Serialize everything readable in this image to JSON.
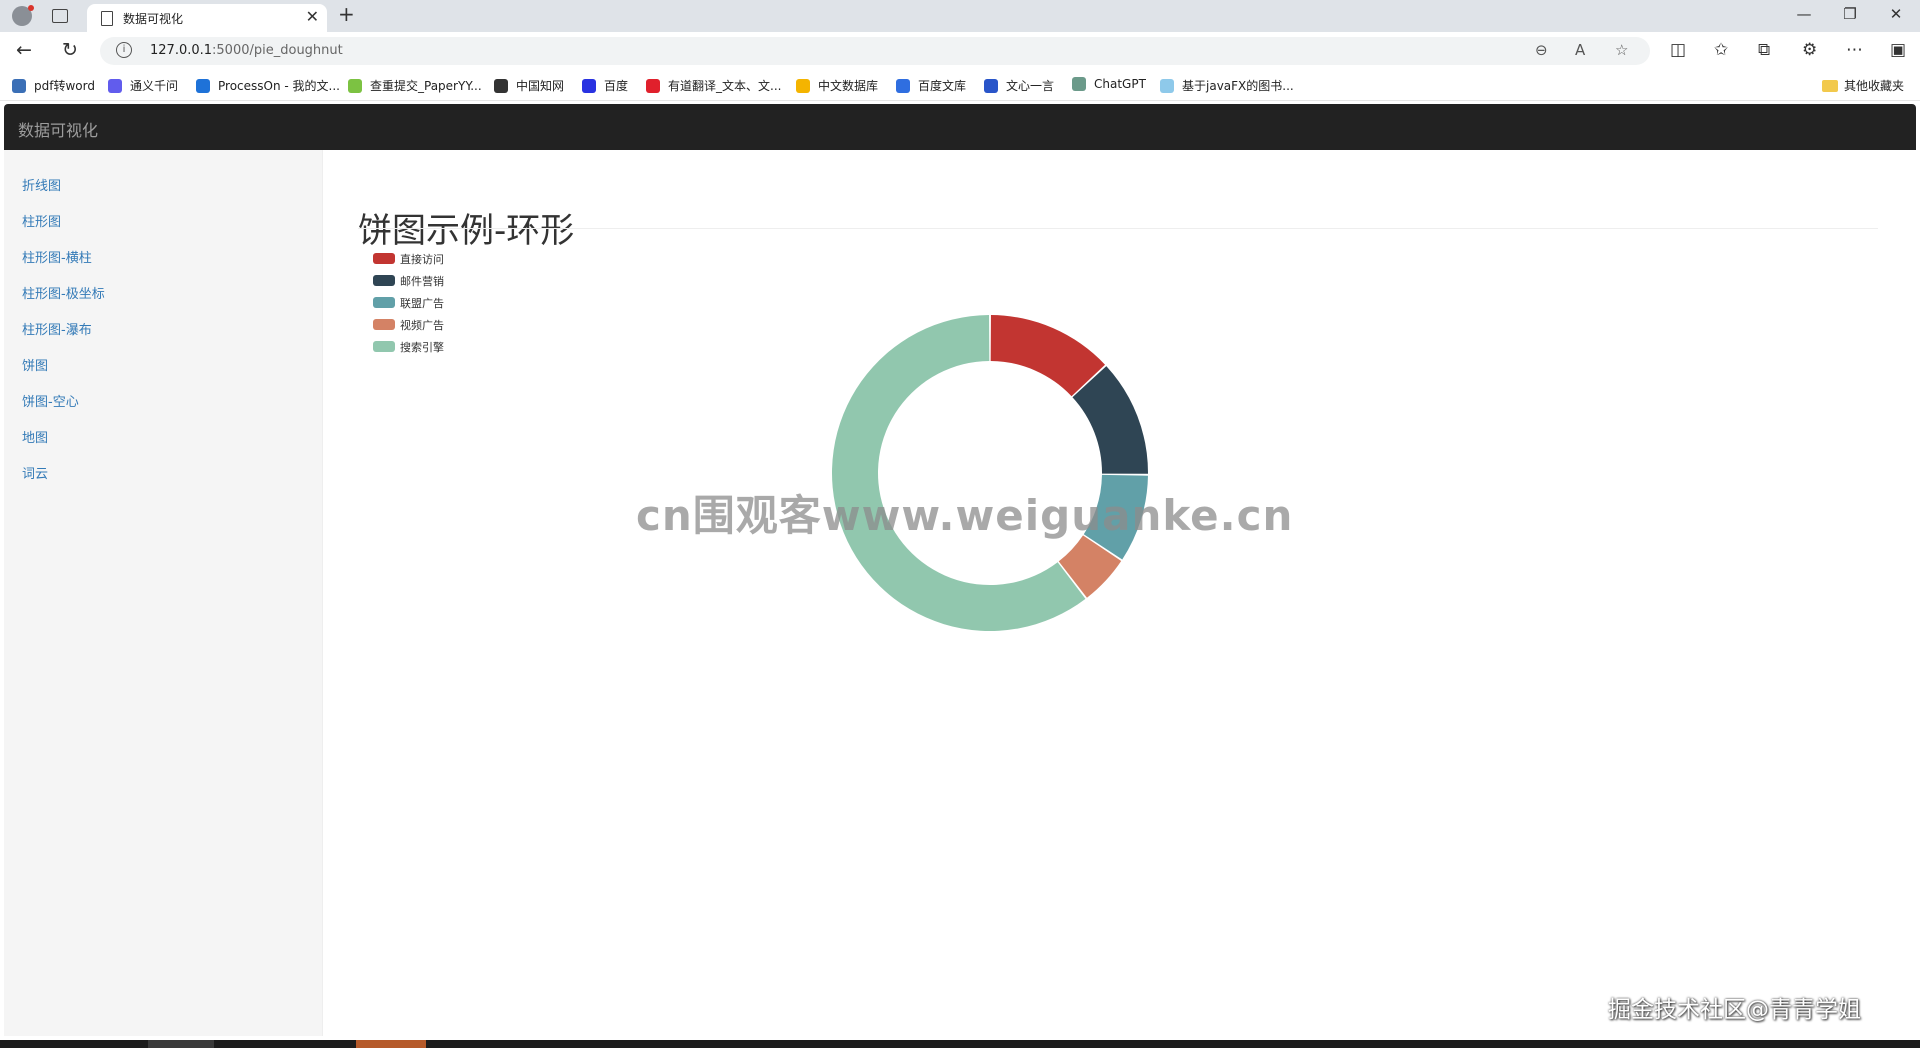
{
  "browser": {
    "tab_title": "数据可视化",
    "url_host": "127.0.0.1",
    "url_rest": ":5000/pie_doughnut",
    "bookmarks": [
      {
        "label": "pdf转word",
        "color": "#3b6fb6"
      },
      {
        "label": "通义千问",
        "color": "#615ced"
      },
      {
        "label": "ProcessOn - 我的文...",
        "color": "#1e72d8"
      },
      {
        "label": "查重提交_PaperYY...",
        "color": "#7cc242"
      },
      {
        "label": "中国知网",
        "color": "#333333"
      },
      {
        "label": "百度",
        "color": "#2932e1"
      },
      {
        "label": "有道翻译_文本、文...",
        "color": "#e0202c"
      },
      {
        "label": "中文数据库",
        "color": "#f4b400"
      },
      {
        "label": "百度文库",
        "color": "#2f6ee0"
      },
      {
        "label": "文心一言",
        "color": "#2955c9"
      },
      {
        "label": "ChatGPT",
        "color": "#6b9a8a"
      },
      {
        "label": "基于javaFX的图书...",
        "color": "#8ec9ea"
      }
    ],
    "other_bookmarks": "其他收藏夹"
  },
  "app": {
    "brand": "数据可视化",
    "menu": [
      "折线图",
      "柱形图",
      "柱形图-横柱",
      "柱形图-极坐标",
      "柱形图-瀑布",
      "饼图",
      "饼图-空心",
      "地图",
      "词云"
    ],
    "page_title": "饼图示例-环形"
  },
  "chart_data": {
    "type": "pie",
    "variant": "doughnut",
    "categories": [
      "直接访问",
      "邮件营销",
      "联盟广告",
      "视频广告",
      "搜索引擎"
    ],
    "values": [
      335,
      310,
      234,
      135,
      1548
    ],
    "colors": [
      "#c23531",
      "#2f4554",
      "#61a0a8",
      "#d48265",
      "#91c7ae"
    ],
    "legend_position": "top-left"
  },
  "watermark": "cn围观客www.weiguanke.cn",
  "credit": "掘金技术社区@青青学姐"
}
